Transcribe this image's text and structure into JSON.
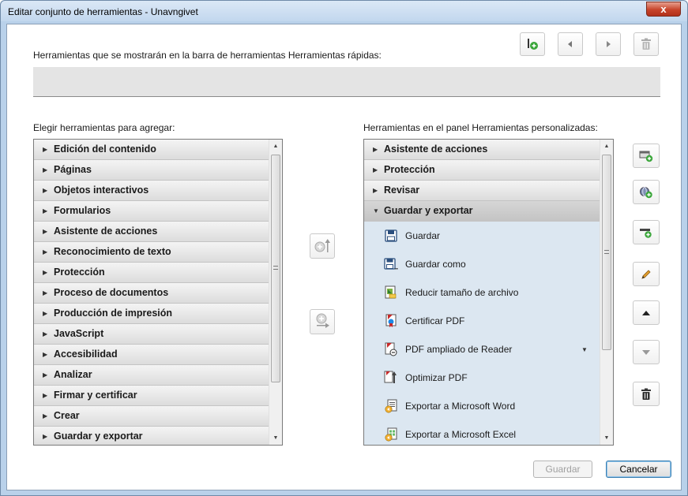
{
  "window": {
    "title": "Editar conjunto de herramientas - Unavngivet",
    "close_label": "x"
  },
  "quick_tools": {
    "label": "Herramientas que se mostrarán en la barra de herramientas Herramientas rápidas:",
    "buttons": [
      {
        "name": "add-separator",
        "icon": "add-divider-icon"
      },
      {
        "name": "move-left",
        "icon": "triangle-left-icon"
      },
      {
        "name": "move-right",
        "icon": "triangle-right-icon"
      },
      {
        "name": "delete",
        "icon": "trash-icon"
      }
    ]
  },
  "choose_tools": {
    "label": "Elegir herramientas para agregar:",
    "groups": [
      "Edición del contenido",
      "Páginas",
      "Objetos interactivos",
      "Formularios",
      "Asistente de acciones",
      "Reconocimiento de texto",
      "Protección",
      "Proceso de documentos",
      "Producción de impresión",
      "JavaScript",
      "Accesibilidad",
      "Analizar",
      "Firmar y certificar",
      "Crear",
      "Guardar y exportar"
    ]
  },
  "custom_tools": {
    "label": "Herramientas en el panel Herramientas personalizadas:",
    "groups": [
      "Asistente de acciones",
      "Protección",
      "Revisar"
    ],
    "open_group": "Guardar y exportar",
    "tools": [
      {
        "label": "Guardar",
        "icon": "floppy-disk-icon"
      },
      {
        "label": "Guardar como",
        "icon": "save-as-icon"
      },
      {
        "label": "Reducir tamaño de archivo",
        "icon": "reduce-size-icon"
      },
      {
        "label": "Certificar PDF",
        "icon": "certify-pdf-icon"
      },
      {
        "label": "PDF ampliado de Reader",
        "icon": "reader-extended-icon",
        "has_dropdown": true
      },
      {
        "label": "Optimizar PDF",
        "icon": "optimize-pdf-icon"
      },
      {
        "label": "Exportar a Microsoft Word",
        "icon": "export-word-icon"
      },
      {
        "label": "Exportar a Microsoft Excel",
        "icon": "export-excel-icon"
      }
    ]
  },
  "buttons": {
    "save": "Guardar",
    "cancel": "Cancelar",
    "save_enabled": false
  },
  "colors": {
    "accent": "#3c7fb1",
    "selection": "#dce7f1",
    "close": "#c7442a",
    "add_green": "#3aa63a"
  }
}
